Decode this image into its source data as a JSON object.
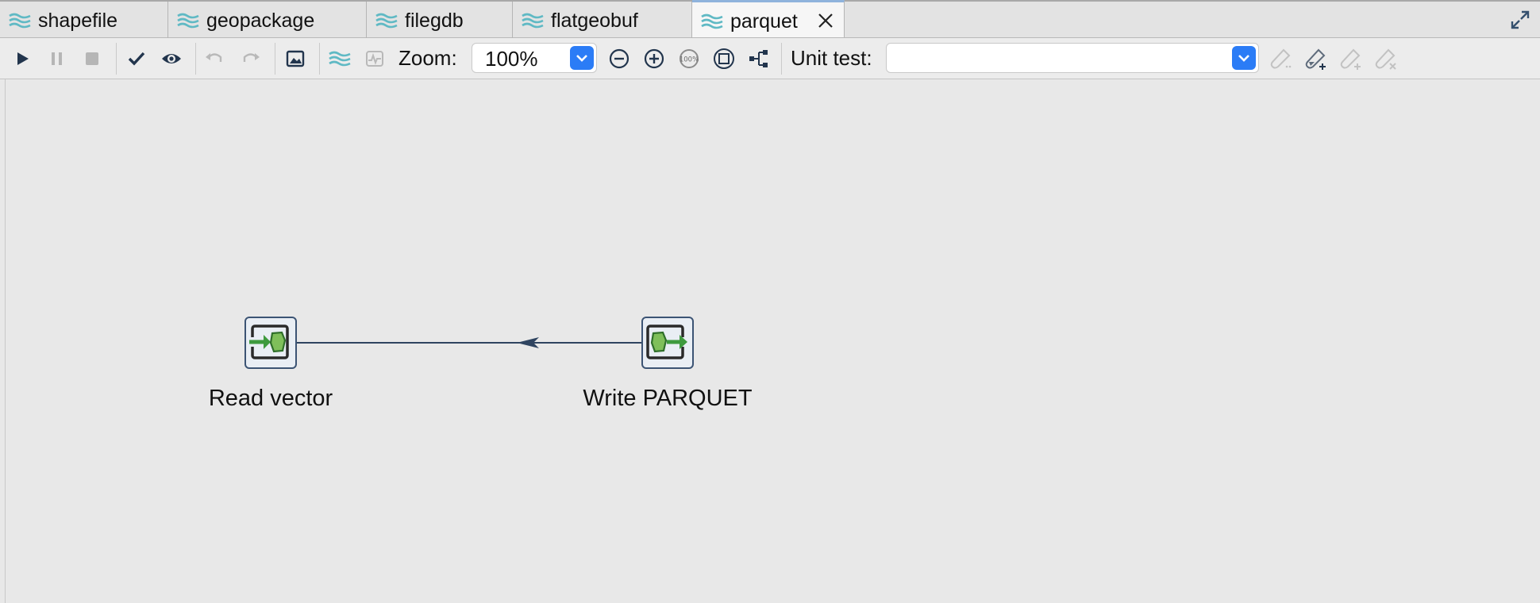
{
  "tabs": [
    {
      "label": "shapefile",
      "icon": "transformation-icon",
      "active": false
    },
    {
      "label": "geopackage",
      "icon": "transformation-icon",
      "active": false
    },
    {
      "label": "filegdb",
      "icon": "transformation-icon",
      "active": false
    },
    {
      "label": "flatgeobuf",
      "icon": "transformation-icon",
      "active": false
    },
    {
      "label": "parquet",
      "icon": "transformation-icon",
      "active": true
    }
  ],
  "toolbar": {
    "zoom_label": "Zoom:",
    "zoom_value": "100%",
    "unit_test_label": "Unit test:",
    "unit_test_value": ""
  },
  "canvas": {
    "steps": [
      {
        "name": "Read vector",
        "type": "input"
      },
      {
        "name": "Write PARQUET",
        "type": "output"
      }
    ]
  },
  "colors": {
    "accent": "#2b7cf6",
    "icon_teal": "#5fb9c4",
    "node_border": "#3c5474",
    "step_green": "#3e9a3e"
  }
}
